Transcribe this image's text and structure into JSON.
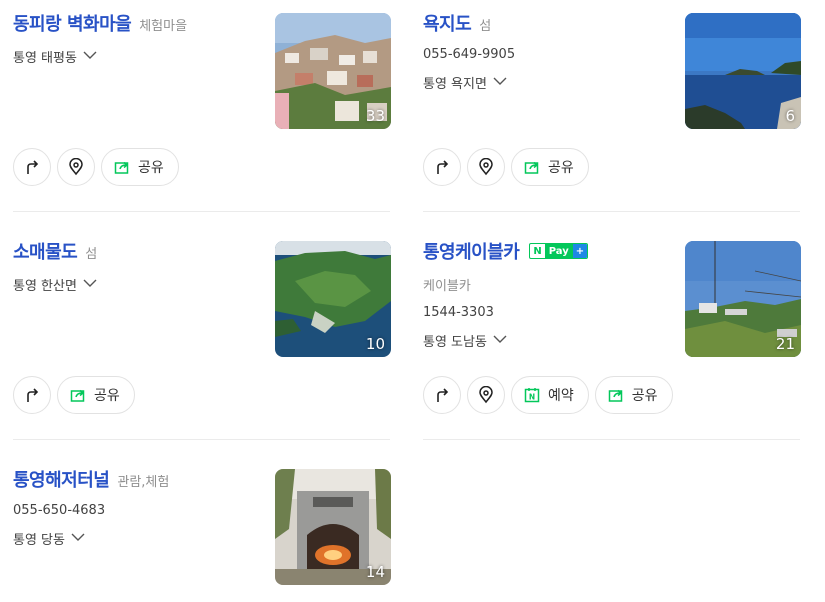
{
  "places": [
    {
      "title": "동피랑 벽화마을",
      "category": "체험마을",
      "address": "통영 태평동",
      "photo_count": "33",
      "buttons": {
        "share": "공유"
      }
    },
    {
      "title": "욕지도",
      "category": "섬",
      "phone": "055-649-9905",
      "address": "통영 욕지면",
      "photo_count": "6",
      "buttons": {
        "share": "공유"
      }
    },
    {
      "title": "소매물도",
      "category": "섬",
      "address": "통영 한산면",
      "photo_count": "10",
      "buttons": {
        "share": "공유"
      }
    },
    {
      "title": "통영케이블카",
      "npay": {
        "n": "N",
        "pay": "Pay",
        "plus": "+"
      },
      "category": "케이블카",
      "phone": "1544-3303",
      "address": "통영 도남동",
      "photo_count": "21",
      "buttons": {
        "reserve": "예약",
        "reserve_icon": "N",
        "share": "공유"
      }
    },
    {
      "title": "통영해저터널",
      "category": "관람,체험",
      "phone": "055-650-4683",
      "address": "통영 당동",
      "photo_count": "14"
    }
  ],
  "colors": {
    "title": "#2852c6",
    "category": "#8f8f8f",
    "text": "#424242",
    "share_green": "#03c75a",
    "border": "#e2e2e2",
    "divider": "#ebebeb"
  },
  "icons": [
    "directions-icon",
    "map-pin-icon",
    "share-icon",
    "chevron-down-icon",
    "naver-reserve-icon",
    "npay-badge"
  ]
}
